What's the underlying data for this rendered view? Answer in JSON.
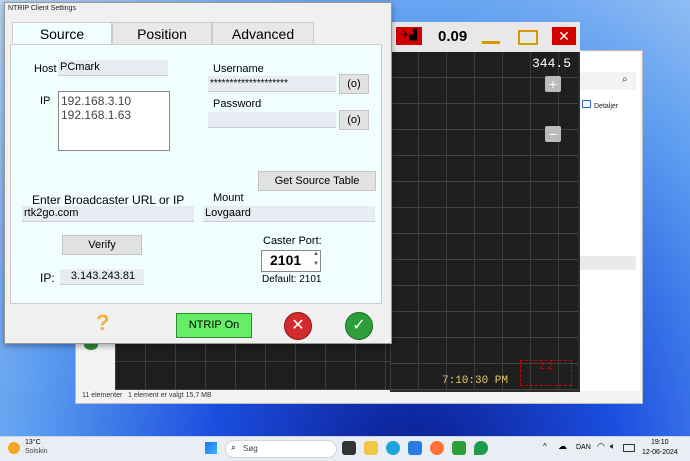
{
  "dialog": {
    "title": "NTRIP Client Settings",
    "tabs": [
      {
        "label": "Source",
        "active": true
      },
      {
        "label": "Position",
        "active": false
      },
      {
        "label": "Advanced",
        "active": false
      }
    ],
    "host_label": "Host",
    "host_value": "PCmark",
    "ip_label": "IP",
    "ip_list": [
      "192.168.3.10",
      "192.168.1.63"
    ],
    "username_label": "Username",
    "username_value": "********************",
    "password_label": "Password",
    "password_value": "",
    "toggle_button_label": "(o)",
    "get_source_table_label": "Get Source Table",
    "broadcaster_label": "Enter Broadcaster URL or IP",
    "broadcaster_value": "rtk2go.com",
    "mount_label": "Mount",
    "mount_value": "Lovgaard",
    "verify_label": "Verify",
    "resolved_ip_label": "IP:",
    "resolved_ip_value": "3.143.243.81",
    "caster_port_label": "Caster Port:",
    "caster_port_value": "2101",
    "default_label": "Default: 2101",
    "help_icon": "?",
    "ntrip_on_label": "NTRIP On",
    "colors": {
      "ntrip_on": "#66ee66",
      "cancel": "#d32b2b",
      "ok": "#2e9e3a",
      "help": "#f2b233"
    }
  },
  "camera_window": {
    "value": "0.09",
    "heading": "344.5",
    "time": "7:10:30 PM",
    "zoom_in": "+",
    "zoom_out": "−"
  },
  "explorer": {
    "detail_label": "Detaljer",
    "status_count": "11 elementer",
    "status_selected": "1 element er valgt 15,7 MB"
  },
  "taskbar": {
    "weather_temp": "13°C",
    "weather_desc": "Solskin",
    "search_label": "Søg",
    "lang": "DAN",
    "time": "19:10",
    "date": "12-06-2024"
  }
}
